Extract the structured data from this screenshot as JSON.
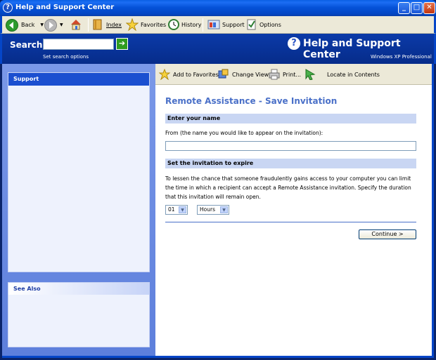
{
  "window": {
    "title": "Help and Support Center",
    "controls": {
      "minimize": "_",
      "maximize": "□",
      "close": "✕"
    }
  },
  "toolbar": {
    "back": "Back",
    "index": "Index",
    "favorites": "Favorites",
    "history": "History",
    "support": "Support",
    "options": "Options"
  },
  "search": {
    "label": "Search",
    "value": "",
    "options_link": "Set search options"
  },
  "brand": {
    "title": "Help and Support Center",
    "subtitle": "Windows XP Professional"
  },
  "sidebar": {
    "support_heading": "Support",
    "see_also_heading": "See Also"
  },
  "content_toolbar": {
    "add_favorites": "Add to Favorites",
    "change_view": "Change View",
    "print": "Print...",
    "locate": "Locate in Contents"
  },
  "main": {
    "page_title": "Remote Assistance - Save Invitation",
    "name_section": "Enter your name",
    "from_label": "From (the name you would like to appear on the invitation):",
    "from_value": "",
    "expire_section": "Set the invitation to expire",
    "expire_text": "To lessen the chance that someone fraudulently gains access to your computer you can limit the time in which a recipient can accept a Remote Assistance invitation. Specify the duration that this invitation will remain open.",
    "duration_value": "01",
    "duration_unit": "Hours",
    "continue_label": "Continue >"
  },
  "colors": {
    "title_blue": "#0553d9",
    "accent_heading": "#4a70c8",
    "section_bar": "#c9d6f3"
  }
}
